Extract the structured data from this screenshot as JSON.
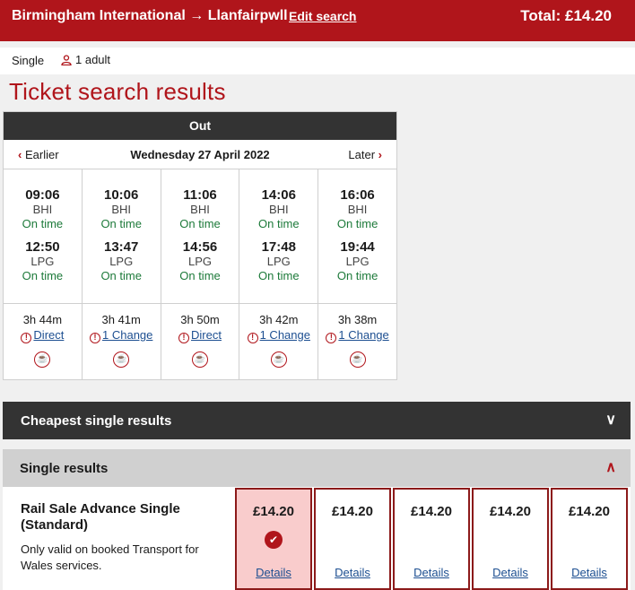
{
  "header": {
    "origin": "Birmingham International",
    "arrow": "→",
    "destination": "Llanfairpwll",
    "edit_label": "Edit search",
    "total_label": "Total: £14.20"
  },
  "subbar": {
    "ticket_type": "Single",
    "passengers": "1 adult"
  },
  "page_title": "Ticket search results",
  "journey": {
    "direction": "Out",
    "earlier_label": "Earlier",
    "date": "Wednesday 27 April 2022",
    "later_label": "Later",
    "services": [
      {
        "dep": "09:06",
        "dep_stn": "BHI",
        "dep_status": "On time",
        "arr": "12:50",
        "arr_stn": "LPG",
        "arr_status": "On time",
        "duration": "3h 44m",
        "changes": "Direct"
      },
      {
        "dep": "10:06",
        "dep_stn": "BHI",
        "dep_status": "On time",
        "arr": "13:47",
        "arr_stn": "LPG",
        "arr_status": "On time",
        "duration": "3h 41m",
        "changes": "1 Change"
      },
      {
        "dep": "11:06",
        "dep_stn": "BHI",
        "dep_status": "On time",
        "arr": "14:56",
        "arr_stn": "LPG",
        "arr_status": "On time",
        "duration": "3h 50m",
        "changes": "Direct"
      },
      {
        "dep": "14:06",
        "dep_stn": "BHI",
        "dep_status": "On time",
        "arr": "17:48",
        "arr_stn": "LPG",
        "arr_status": "On time",
        "duration": "3h 42m",
        "changes": "1 Change"
      },
      {
        "dep": "16:06",
        "dep_stn": "BHI",
        "dep_status": "On time",
        "arr": "19:44",
        "arr_stn": "LPG",
        "arr_status": "On time",
        "duration": "3h 38m",
        "changes": "1 Change"
      }
    ]
  },
  "sections": {
    "cheapest_label": "Cheapest single results",
    "single_label": "Single results"
  },
  "fare": {
    "name": "Rail Sale Advance Single (Standard)",
    "note": "Only valid on booked Transport for Wales services.",
    "details_label": "Details",
    "prices": [
      "£14.20",
      "£14.20",
      "£14.20",
      "£14.20",
      "£14.20"
    ],
    "selected_index": 0
  },
  "colors": {
    "brand": "#b0151b",
    "dark": "#333333",
    "on_time": "#1d7a3a",
    "link": "#1d4f91"
  },
  "icons": {
    "passenger": "person-icon",
    "warning": "warning-icon",
    "catering": "catering-icon",
    "selected": "check-icon"
  }
}
